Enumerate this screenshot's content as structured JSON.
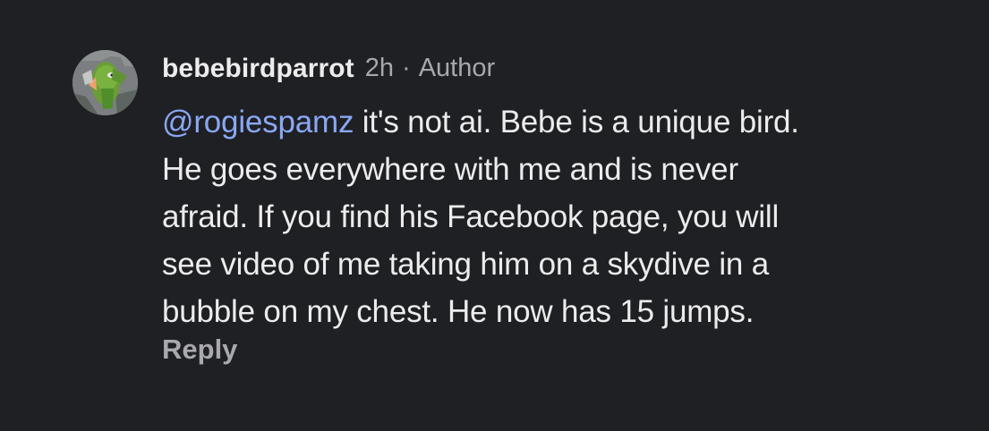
{
  "comment": {
    "avatar_icon": "parrot-avatar",
    "author": "bebebirdparrot",
    "time": "2h",
    "separator": "·",
    "badge": "Author",
    "mention": "@rogiespamz",
    "text_lines": [
      " it's not ai. Bebe is a unique bird.",
      "He goes everywhere with me and is never",
      "afraid. If you find his Facebook page, you will",
      "see video of me taking him on a skydive in a",
      "bubble on my chest. He now has 15 jumps."
    ],
    "reply_label": "Reply"
  },
  "colors": {
    "background": "#1f2024",
    "primary_text": "#ececec",
    "secondary_text": "#a8a8ac",
    "mention": "#8aa7f3"
  }
}
